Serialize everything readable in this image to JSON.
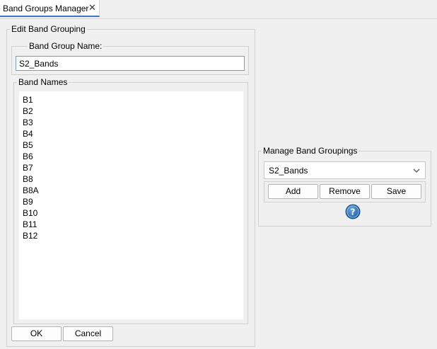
{
  "tab": {
    "title": "Band Groups Manager",
    "close_glyph": "✕"
  },
  "edit_group": {
    "legend": "Edit Band Grouping",
    "name_label": "Band Group Name:",
    "name_value": "S2_Bands",
    "band_names_legend": "Band Names",
    "bands": [
      "B1",
      "B2",
      "B3",
      "B4",
      "B5",
      "B6",
      "B7",
      "B8",
      "B8A",
      "B9",
      "B10",
      "B11",
      "B12"
    ]
  },
  "buttons": {
    "ok": "OK",
    "cancel": "Cancel"
  },
  "manage": {
    "legend": "Manage Band Groupings",
    "selected": "S2_Bands",
    "add": "Add",
    "remove": "Remove",
    "save": "Save",
    "help_icon": "help-icon"
  },
  "colors": {
    "accent": "#3c78c8",
    "help_icon": "#2a6fb0",
    "input_border": "#7a9cc6"
  }
}
